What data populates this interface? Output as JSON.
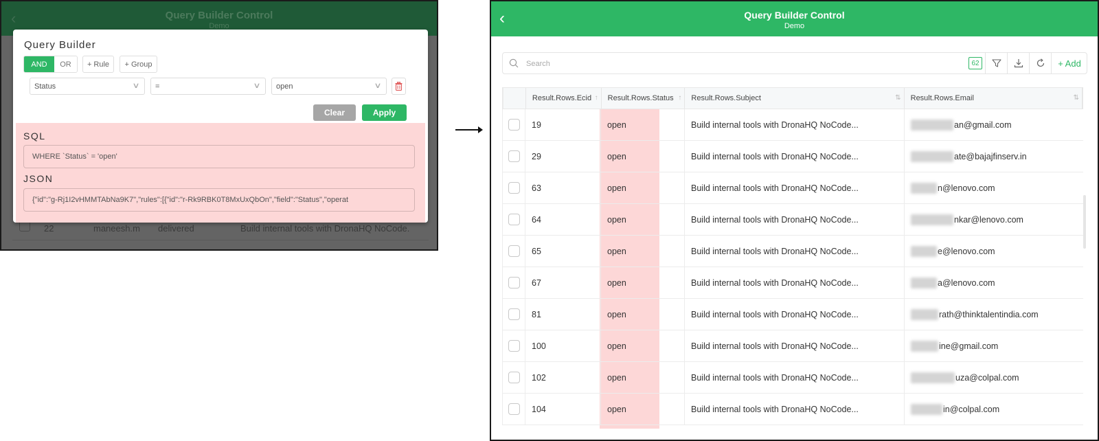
{
  "left_screenshot": {
    "app_header": {
      "title": "Query Builder Control",
      "subtitle": "Demo"
    },
    "background_row": {
      "id": "22",
      "name": "maneesh.m",
      "status": "delivered",
      "subject": "Build internal tools with DronaHQ NoCode."
    },
    "query_builder": {
      "title": "Query Builder",
      "combinator": {
        "options": [
          "AND",
          "OR"
        ],
        "selected": "AND"
      },
      "add_rule_label": "+ Rule",
      "add_group_label": "+ Group",
      "rule": {
        "field": "Status",
        "operator": "=",
        "value": "open"
      },
      "clear_label": "Clear",
      "apply_label": "Apply",
      "sql_label": "SQL",
      "sql_value": "WHERE `Status` = 'open'",
      "json_label": "JSON",
      "json_value": "{\"id\":\"g-Rj1I2vHMMTAbNa9K7\",\"rules\":[{\"id\":\"r-Rk9RBK0T8MxUxQbOn\",\"field\":\"Status\",\"operat"
    }
  },
  "right_screenshot": {
    "app_header": {
      "title": "Query Builder Control",
      "subtitle": "Demo"
    },
    "toolbar": {
      "search_placeholder": "Search",
      "count": "62",
      "add_label": "+ Add"
    },
    "table": {
      "columns": [
        "Result.Rows.Ecid",
        "Result.Rows.Status",
        "Result.Rows.Subject",
        "Result.Rows.Email"
      ],
      "rows": [
        {
          "ecid": "19",
          "status": "open",
          "subject": "Build internal tools with DronaHQ NoCode...",
          "email": "an@gmail.com"
        },
        {
          "ecid": "29",
          "status": "open",
          "subject": "Build internal tools with DronaHQ NoCode...",
          "email": "ate@bajajfinserv.in"
        },
        {
          "ecid": "63",
          "status": "open",
          "subject": "Build internal tools with DronaHQ NoCode...",
          "email": "n@lenovo.com"
        },
        {
          "ecid": "64",
          "status": "open",
          "subject": "Build internal tools with DronaHQ NoCode...",
          "email": "nkar@lenovo.com"
        },
        {
          "ecid": "65",
          "status": "open",
          "subject": "Build internal tools with DronaHQ NoCode...",
          "email": "e@lenovo.com"
        },
        {
          "ecid": "67",
          "status": "open",
          "subject": "Build internal tools with DronaHQ NoCode...",
          "email": "a@lenovo.com"
        },
        {
          "ecid": "81",
          "status": "open",
          "subject": "Build internal tools with DronaHQ NoCode...",
          "email": "rath@thinktalentindia.com"
        },
        {
          "ecid": "100",
          "status": "open",
          "subject": "Build internal tools with DronaHQ NoCode...",
          "email": "ine@gmail.com"
        },
        {
          "ecid": "102",
          "status": "open",
          "subject": "Build internal tools with DronaHQ NoCode...",
          "email": "uza@colpal.com"
        },
        {
          "ecid": "104",
          "status": "open",
          "subject": "Build internal tools with DronaHQ NoCode...",
          "email": "in@colpal.com"
        }
      ]
    }
  },
  "colors": {
    "brand_green": "#2eb765",
    "highlight_pink": "#fdd7d7",
    "clear_gray": "#a6a6a6",
    "delete_red": "#e05a5a"
  }
}
